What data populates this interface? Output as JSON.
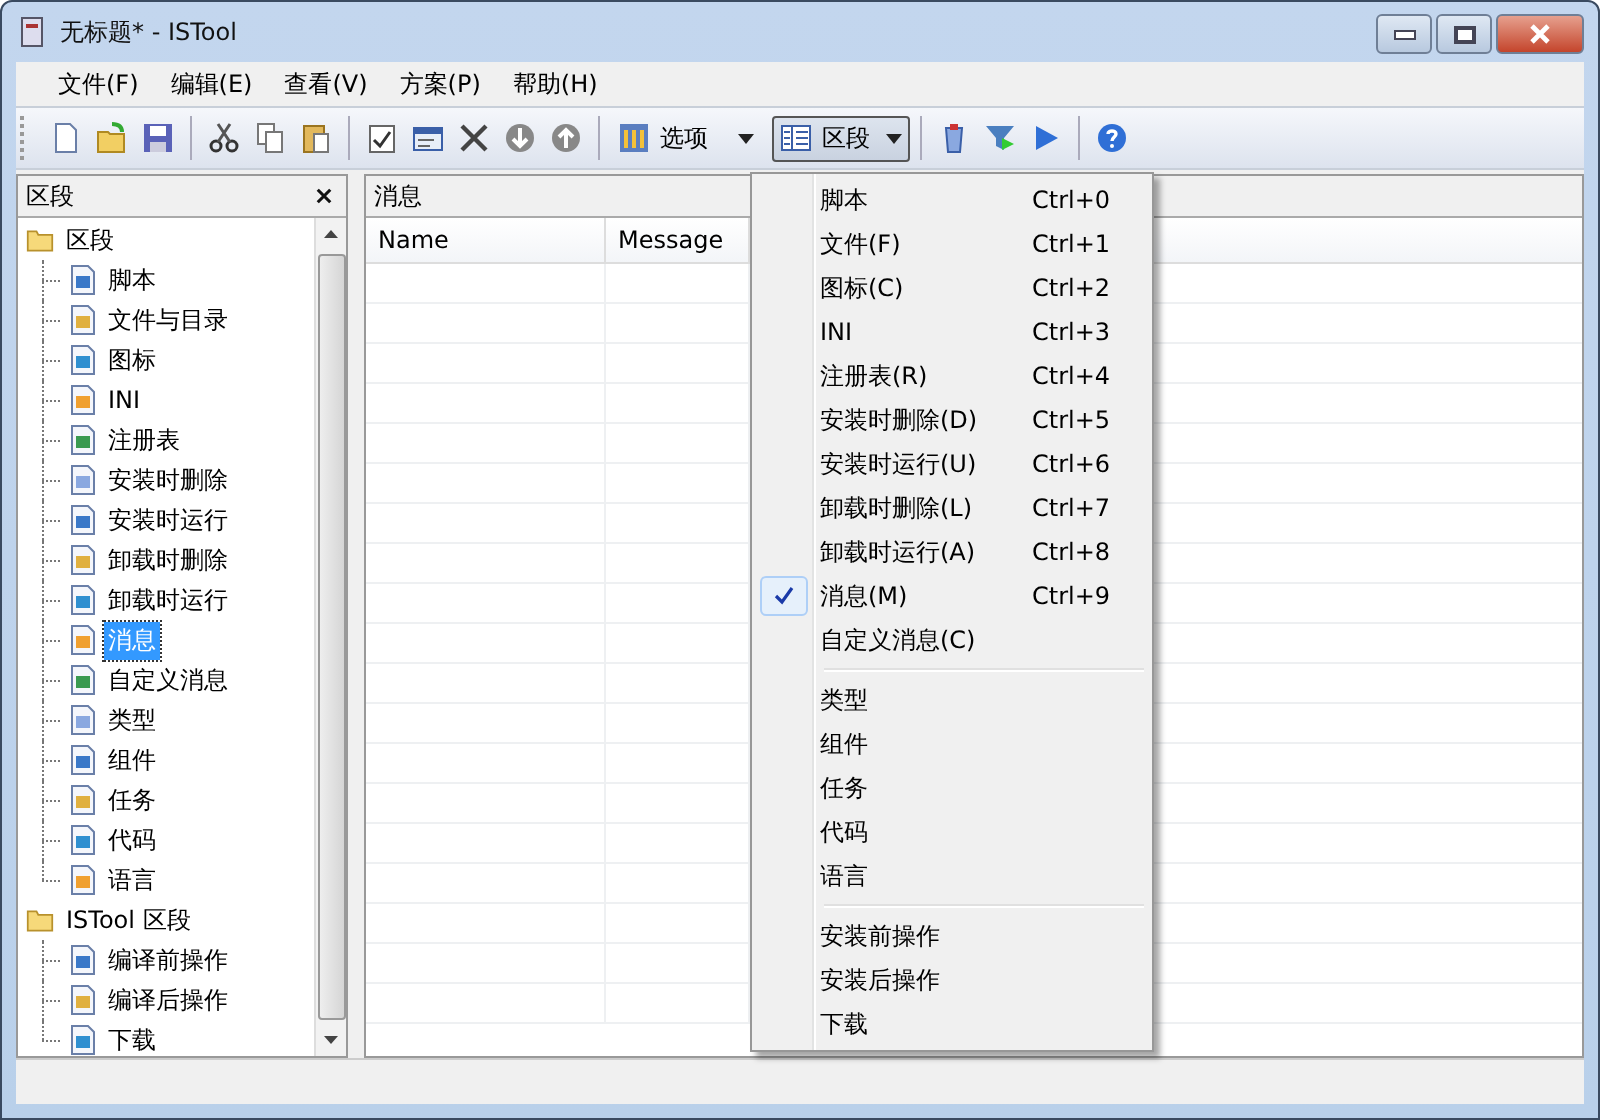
{
  "window": {
    "title": "无标题* - ISTool"
  },
  "menu_bar": [
    {
      "label": "文件(F)"
    },
    {
      "label": "编辑(E)"
    },
    {
      "label": "查看(V)"
    },
    {
      "label": "方案(P)"
    },
    {
      "label": "帮助(H)"
    }
  ],
  "toolbar": [
    {
      "kind": "icon"
    },
    {
      "kind": "icon"
    },
    {
      "kind": "icon"
    },
    {
      "kind": "separator"
    },
    {
      "kind": "icon"
    },
    {
      "kind": "icon"
    },
    {
      "kind": "icon"
    },
    {
      "kind": "separator"
    },
    {
      "kind": "icon"
    },
    {
      "kind": "icon"
    },
    {
      "kind": "icon"
    },
    {
      "kind": "icon"
    },
    {
      "kind": "icon"
    },
    {
      "kind": "separator"
    },
    {
      "kind": "text-button",
      "label": "选项",
      "pressed": false
    },
    {
      "kind": "text-button",
      "label": "区段",
      "pressed": true
    },
    {
      "kind": "separator"
    },
    {
      "kind": "icon"
    },
    {
      "kind": "icon"
    },
    {
      "kind": "icon"
    },
    {
      "kind": "separator"
    },
    {
      "kind": "icon"
    }
  ],
  "sections_panel": {
    "title": "区段",
    "tree": [
      {
        "label": "区段",
        "selected": false,
        "children": [
          {
            "label": "脚本",
            "selected": false
          },
          {
            "label": "文件与目录",
            "selected": false
          },
          {
            "label": "图标",
            "selected": false
          },
          {
            "label": "INI",
            "selected": false
          },
          {
            "label": "注册表",
            "selected": false
          },
          {
            "label": "安装时删除",
            "selected": false
          },
          {
            "label": "安装时运行",
            "selected": false
          },
          {
            "label": "卸载时删除",
            "selected": false
          },
          {
            "label": "卸载时运行",
            "selected": false
          },
          {
            "label": "消息",
            "selected": true
          },
          {
            "label": "自定义消息",
            "selected": false
          },
          {
            "label": "类型",
            "selected": false
          },
          {
            "label": "组件",
            "selected": false
          },
          {
            "label": "任务",
            "selected": false
          },
          {
            "label": "代码",
            "selected": false
          },
          {
            "label": "语言",
            "selected": false
          }
        ]
      },
      {
        "label": "ISTool 区段",
        "selected": false,
        "children": [
          {
            "label": "编译前操作",
            "selected": false
          },
          {
            "label": "编译后操作",
            "selected": false
          },
          {
            "label": "下载",
            "selected": false
          }
        ]
      }
    ]
  },
  "content_panel": {
    "title": "消息",
    "table": {
      "columns": [
        "Name",
        "Message"
      ]
    }
  },
  "dropdown_menu": {
    "groups": [
      [
        {
          "label": "脚本",
          "shortcut": "Ctrl+0",
          "checked": false
        },
        {
          "label": "文件(F)",
          "shortcut": "Ctrl+1",
          "checked": false
        },
        {
          "label": "图标(C)",
          "shortcut": "Ctrl+2",
          "checked": false
        },
        {
          "label": "INI",
          "shortcut": "Ctrl+3",
          "checked": false
        },
        {
          "label": "注册表(R)",
          "shortcut": "Ctrl+4",
          "checked": false
        },
        {
          "label": "安装时删除(D)",
          "shortcut": "Ctrl+5",
          "checked": false
        },
        {
          "label": "安装时运行(U)",
          "shortcut": "Ctrl+6",
          "checked": false
        },
        {
          "label": "卸载时删除(L)",
          "shortcut": "Ctrl+7",
          "checked": false
        },
        {
          "label": "卸载时运行(A)",
          "shortcut": "Ctrl+8",
          "checked": false
        },
        {
          "label": "消息(M)",
          "shortcut": "Ctrl+9",
          "checked": true
        },
        {
          "label": "自定义消息(C)",
          "checked": false
        }
      ],
      [
        {
          "label": "类型",
          "checked": false
        },
        {
          "label": "组件",
          "checked": false
        },
        {
          "label": "任务",
          "checked": false
        },
        {
          "label": "代码",
          "checked": false
        },
        {
          "label": "语言",
          "checked": false
        }
      ],
      [
        {
          "label": "安装前操作",
          "checked": false
        },
        {
          "label": "安装后操作",
          "checked": false
        },
        {
          "label": "下载",
          "checked": false
        }
      ]
    ]
  }
}
